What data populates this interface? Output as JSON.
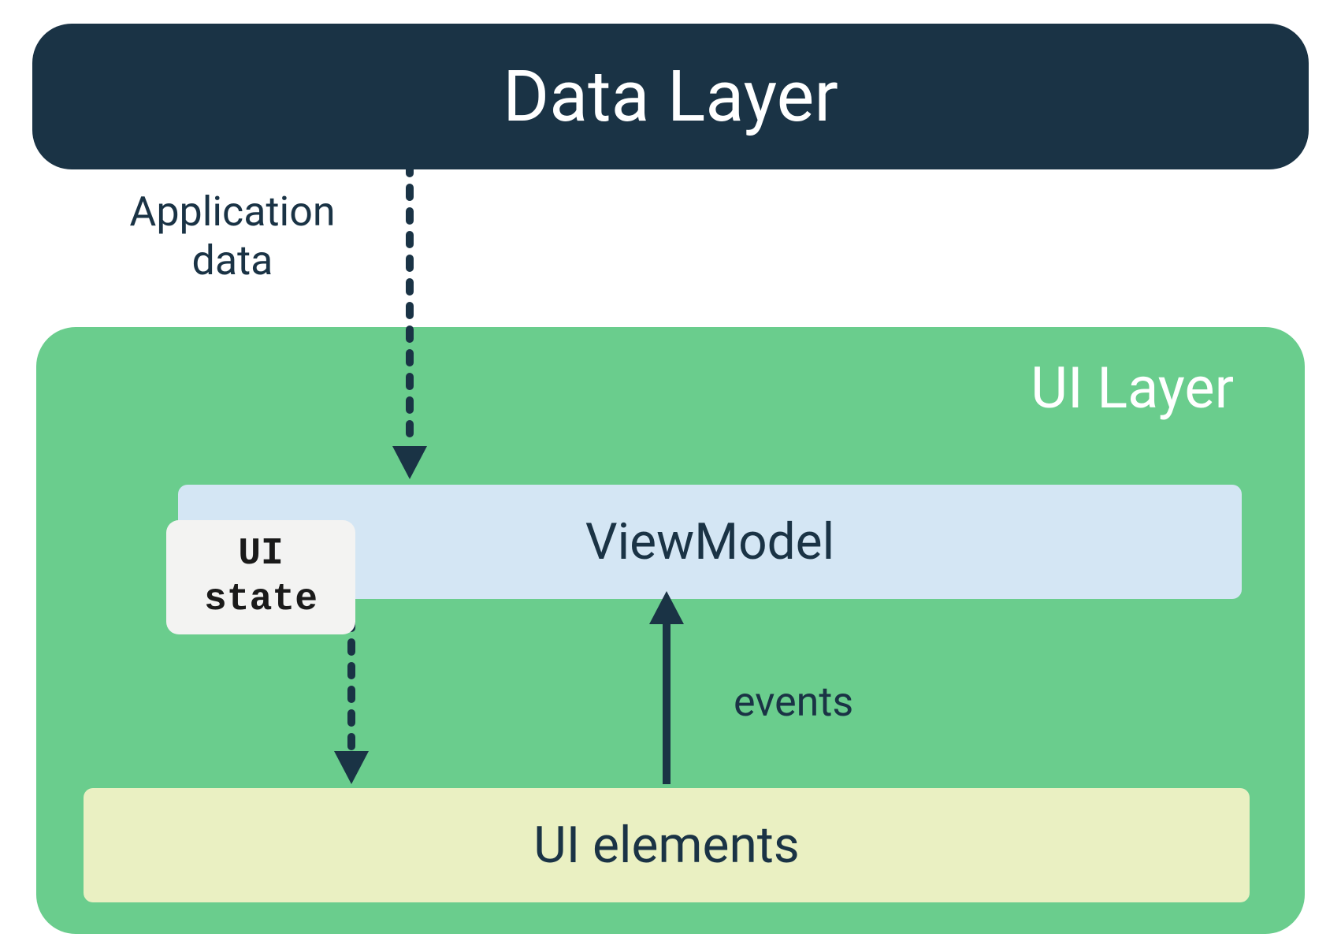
{
  "data_layer": {
    "title": "Data Layer"
  },
  "arrows": {
    "app_data_label": "Application data",
    "events_label": "events"
  },
  "ui_layer": {
    "title": "UI Layer",
    "viewmodel": {
      "label": "ViewModel",
      "ui_state_label_line1": "UI",
      "ui_state_label_line2": "state"
    },
    "ui_elements": {
      "label": "UI elements"
    }
  },
  "colors": {
    "dark_navy": "#1a3345",
    "green": "#6acd8d",
    "light_blue": "#d4e6f4",
    "light_yellow": "#eaf0c2",
    "light_gray": "#f3f3f2"
  }
}
